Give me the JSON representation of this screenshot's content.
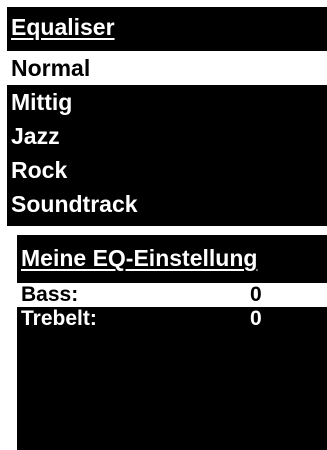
{
  "equaliser": {
    "title": "Equaliser",
    "items": [
      {
        "label": "Normal",
        "selected": true
      },
      {
        "label": "Mittig",
        "selected": false
      },
      {
        "label": "Jazz",
        "selected": false
      },
      {
        "label": "Rock",
        "selected": false
      },
      {
        "label": "Soundtrack",
        "selected": false
      }
    ]
  },
  "my_eq": {
    "title": "Meine EQ-Einstellung",
    "rows": [
      {
        "label": "Bass:",
        "value": "0",
        "selected": true
      },
      {
        "label": "Trebelt:",
        "value": "0",
        "selected": false
      }
    ]
  },
  "colors": {
    "screen_background": "#000000",
    "text": "#ffffff",
    "highlight_background": "#ffffff",
    "highlight_text": "#000000"
  }
}
